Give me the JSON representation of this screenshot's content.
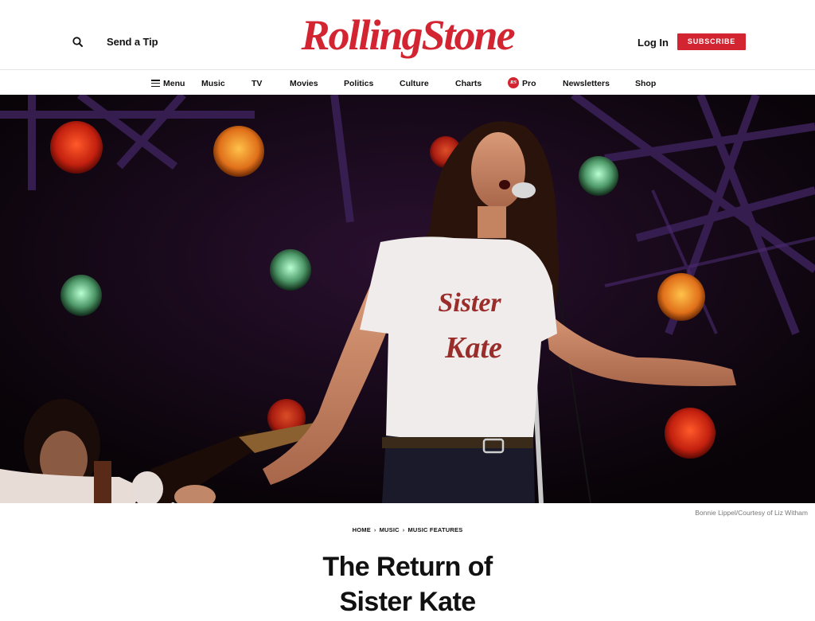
{
  "header": {
    "search_icon": "search-icon",
    "send_tip": "Send a Tip",
    "logo_text": "RollingStone",
    "login": "Log In",
    "subscribe": "SUBSCRIBE",
    "brand_color": "#d32531"
  },
  "nav": {
    "menu": "Menu",
    "items": [
      "Music",
      "TV",
      "Movies",
      "Politics",
      "Culture",
      "Charts",
      "Pro",
      "Newsletters",
      "Shop"
    ],
    "pro_badge": "RS"
  },
  "hero": {
    "shirt_text_1": "Sister",
    "shirt_text_2": "Kate",
    "credit": "Bonnie Lippel/Courtesy of Liz Witham"
  },
  "article": {
    "breadcrumb": [
      "HOME",
      "MUSIC",
      "MUSIC FEATURES"
    ],
    "title_line1": "The Return of",
    "title_line2": "Sister Kate"
  }
}
